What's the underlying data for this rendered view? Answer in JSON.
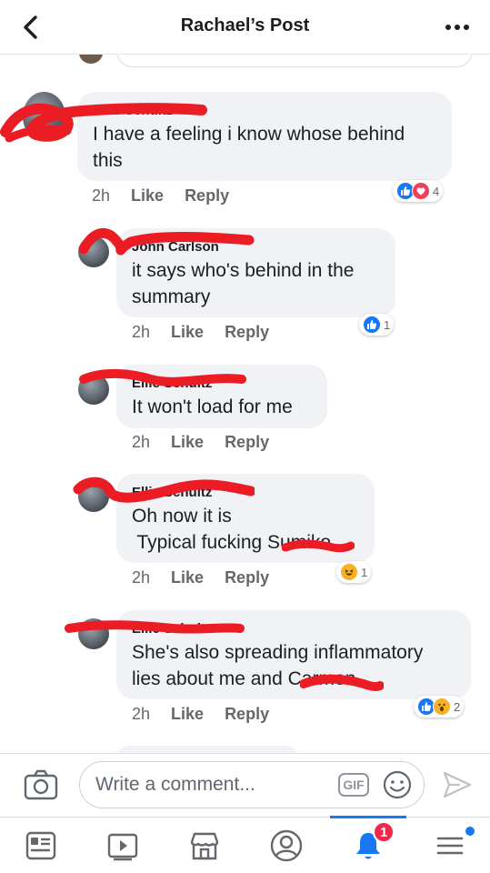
{
  "header": {
    "title": "Rachael’s Post"
  },
  "comments": [
    {
      "name": "Ellie Schultz",
      "text": "I have a feeling i know whose behind this",
      "time": "2h",
      "like_label": "Like",
      "reply_label": "Reply",
      "reaction_count": "4",
      "reactions": [
        "like",
        "love"
      ]
    },
    {
      "name": "John Carlson",
      "text": "it says who's behind in the summary",
      "time": "2h",
      "like_label": "Like",
      "reply_label": "Reply",
      "reaction_count": "1",
      "reactions": [
        "like"
      ]
    },
    {
      "name": "Ellie Schultz",
      "text": "It won't load for me",
      "time": "2h",
      "like_label": "Like",
      "reply_label": "Reply",
      "reaction_count": "",
      "reactions": []
    },
    {
      "name": "Ellie Schultz",
      "text_line1": "Oh now it is",
      "text_line2": " Typical fucking Sumiko.",
      "time": "2h",
      "like_label": "Like",
      "reply_label": "Reply",
      "reaction_count": "1",
      "reactions": [
        "haha"
      ]
    },
    {
      "name": "Ellie Schultz",
      "text": "She's also spreading inflammatory lies about me and Carmen",
      "time": "2h",
      "like_label": "Like",
      "reply_label": "Reply",
      "reaction_count": "2",
      "reactions": [
        "like",
        "wow"
      ]
    }
  ],
  "composer": {
    "placeholder": "Write a comment...",
    "gif_label": "GIF"
  },
  "tabbar": {
    "items": [
      {
        "name": "news-feed",
        "icon": "news-feed-icon"
      },
      {
        "name": "watch",
        "icon": "video-play-icon"
      },
      {
        "name": "marketplace",
        "icon": "storefront-icon"
      },
      {
        "name": "profile",
        "icon": "profile-icon"
      },
      {
        "name": "notifications",
        "icon": "bell-icon",
        "badge": "1",
        "active": true
      },
      {
        "name": "menu",
        "icon": "hamburger-menu-icon",
        "dot": true
      }
    ]
  },
  "colors": {
    "accent": "#1877f2",
    "badge": "#f02849",
    "redaction": "#ec1c24",
    "bubble": "#f0f2f5",
    "meta_text": "#65676b"
  }
}
